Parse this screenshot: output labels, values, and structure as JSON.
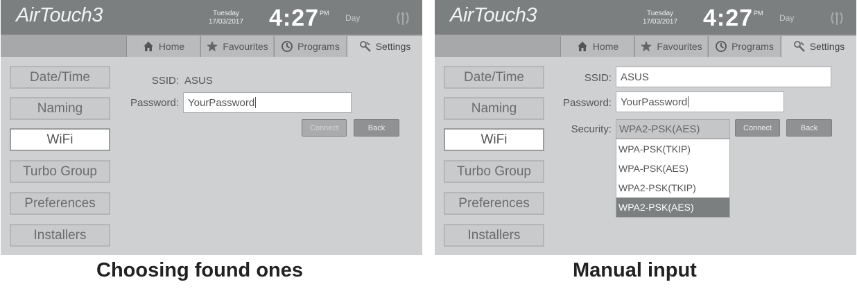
{
  "app": {
    "brand": "AirTouch3",
    "day": "Tuesday",
    "date": "17/03/2017",
    "time": "4:27",
    "ampm": "PM",
    "mode": "Day"
  },
  "tabs": {
    "home": "Home",
    "favourites": "Favourites",
    "programs": "Programs",
    "settings": "Settings"
  },
  "menu": [
    "Date/Time",
    "Naming",
    "WiFi",
    "Turbo Group",
    "Preferences",
    "Installers"
  ],
  "left_panel": {
    "ssid_label": "SSID:",
    "ssid_value": "ASUS",
    "password_label": "Password:",
    "password_value": "YourPassword",
    "connect": "Connect",
    "back": "Back",
    "caption": "Choosing found ones"
  },
  "right_panel": {
    "ssid_label": "SSID:",
    "ssid_value": "ASUS",
    "password_label": "Password:",
    "password_value": "YourPassword",
    "security_label": "Security:",
    "security_value": "WPA2-PSK(AES)",
    "security_options": [
      "WPA-PSK(TKIP)",
      "WPA-PSK(AES)",
      "WPA2-PSK(TKIP)",
      "WPA2-PSK(AES)"
    ],
    "connect": "Connect",
    "back": "Back",
    "caption": "Manual input"
  },
  "colors": {
    "header": "#7c7f80",
    "panel": "#cfd0d1",
    "selected_option": "#7c7f80"
  }
}
